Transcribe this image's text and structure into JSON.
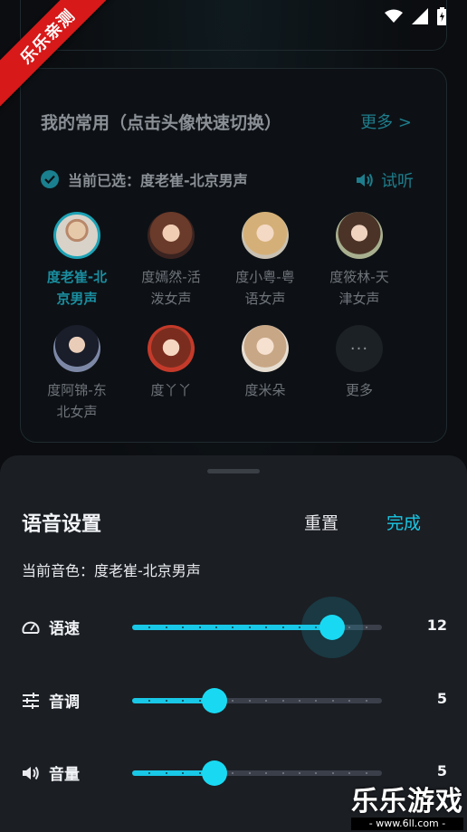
{
  "watermark": {
    "ribbon": "乐乐亲测",
    "brand": "乐乐游戏",
    "url": "- www.6ll.com -"
  },
  "favorites": {
    "title": "我的常用（点击头像快速切换）",
    "more": "更多 >",
    "selected_label": "当前已选：度老崔-北京男声",
    "listen": "试听",
    "voices": [
      {
        "line1": "度老崔-北",
        "line2": "京男声",
        "selected": true
      },
      {
        "line1": "度嫣然-活",
        "line2": "泼女声",
        "selected": false
      },
      {
        "line1": "度小粤-粤",
        "line2": "语女声",
        "selected": false
      },
      {
        "line1": "度筱林-天",
        "line2": "津女声",
        "selected": false
      },
      {
        "line1": "度阿锦-东",
        "line2": "北女声",
        "selected": false
      },
      {
        "line1": "度丫丫",
        "line2": "",
        "selected": false
      },
      {
        "line1": "度米朵",
        "line2": "",
        "selected": false
      },
      {
        "line1": "更多",
        "line2": "",
        "selected": false
      }
    ],
    "more_icon": "···"
  },
  "sheet": {
    "title": "语音设置",
    "reset": "重置",
    "done": "完成",
    "current_voice": "当前音色：度老崔-北京男声",
    "settings": [
      {
        "label": "语速",
        "icon": "speedometer-icon",
        "value": "12",
        "fraction": 0.8
      },
      {
        "label": "音调",
        "icon": "sliders-icon",
        "value": "5",
        "fraction": 0.33
      },
      {
        "label": "音量",
        "icon": "speaker-icon",
        "value": "5",
        "fraction": 0.33
      }
    ]
  },
  "colors": {
    "accent": "#19c8e6",
    "muted_accent": "#1e7d8c",
    "sheet_bg": "#1b1e23"
  }
}
